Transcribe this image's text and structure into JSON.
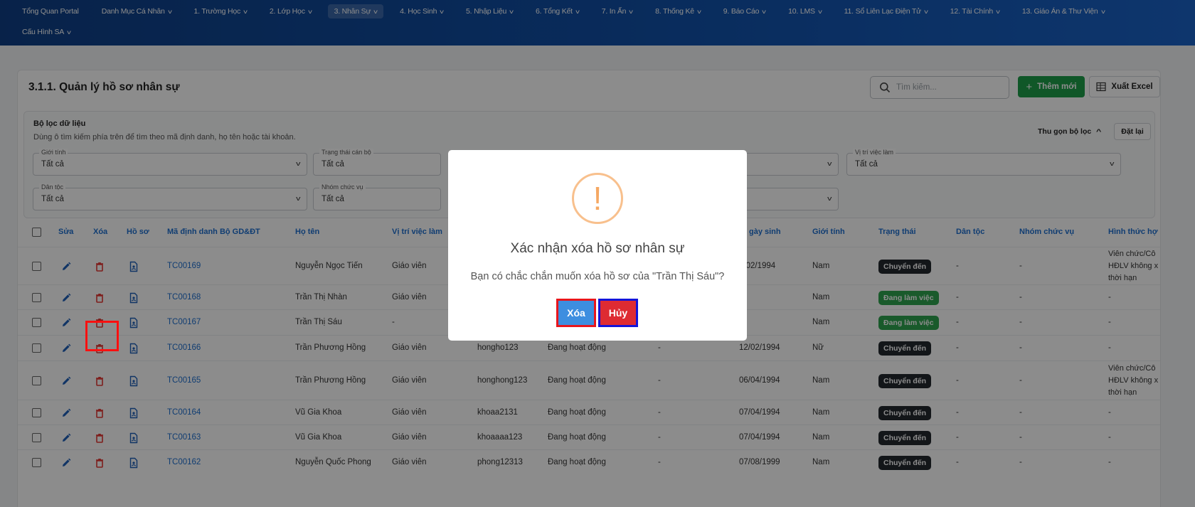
{
  "nav": {
    "row1": [
      {
        "label": "Tổng Quan Portal",
        "chevron": false,
        "active": false
      },
      {
        "label": "Danh Mục Cá Nhân",
        "chevron": true,
        "active": false
      },
      {
        "label": "1. Trường Học",
        "chevron": true,
        "active": false
      },
      {
        "label": "2. Lớp Học",
        "chevron": true,
        "active": false
      },
      {
        "label": "3. Nhân Sự",
        "chevron": true,
        "active": true
      },
      {
        "label": "4. Học Sinh",
        "chevron": true,
        "active": false
      },
      {
        "label": "5. Nhập Liệu",
        "chevron": true,
        "active": false
      },
      {
        "label": "6. Tổng Kết",
        "chevron": true,
        "active": false
      },
      {
        "label": "7. In Ấn",
        "chevron": true,
        "active": false
      },
      {
        "label": "8. Thống Kê",
        "chevron": true,
        "active": false
      },
      {
        "label": "9. Báo Cáo",
        "chevron": true,
        "active": false
      },
      {
        "label": "10. LMS",
        "chevron": true,
        "active": false
      },
      {
        "label": "11. Sổ Liên Lạc Điện Tử",
        "chevron": true,
        "active": false
      },
      {
        "label": "12. Tài Chính",
        "chevron": true,
        "active": false
      },
      {
        "label": "13. Giáo Án & Thư Viện",
        "chevron": true,
        "active": false
      }
    ],
    "row2": [
      {
        "label": "Cấu Hình SA",
        "chevron": true,
        "active": false
      }
    ]
  },
  "page": {
    "title": "3.1.1. Quản lý hồ sơ nhân sự",
    "search_placeholder": "Tìm kiếm...",
    "add_label": "Thêm mới",
    "excel_label": "Xuất Excel"
  },
  "filter": {
    "title": "Bộ lọc dữ liệu",
    "description": "Dùng ô tìm kiếm phía trên để tìm theo mã định danh, họ tên hoặc tài khoản.",
    "collapse_label": "Thu gọn bộ lọc",
    "reset_label": "Đặt lại",
    "fields": [
      {
        "label": "Giới tính",
        "value": "Tất cả"
      },
      {
        "label": "Trạng thái cán bộ",
        "value": "Tất cả"
      },
      {
        "label": "",
        "value": ""
      },
      {
        "label": "Vị trí việc làm",
        "value": "Tất cả"
      },
      {
        "label": "Dân tộc",
        "value": "Tất cả"
      },
      {
        "label": "Nhóm chức vụ",
        "value": "Tất cả"
      },
      {
        "label": "",
        "value": ""
      }
    ]
  },
  "table": {
    "headers": [
      "Sửa",
      "Xóa",
      "Hồ sơ",
      "Mã định danh Bộ GD&ĐT",
      "Họ tên",
      "Vị trí việc làm",
      "gày sinh",
      "Giới tính",
      "Trạng thái",
      "Dân tộc",
      "Nhóm chức vụ",
      "Hình thức hợ"
    ],
    "rows": [
      {
        "code": "TC00169",
        "name": "Nguyễn Ngọc Tiến",
        "position": "Giáo viên",
        "account": "",
        "status_text": "",
        "col8": "",
        "dob": "2/02/1994",
        "gender": "Nam",
        "state": "Chuyển đến",
        "state_color": "dark",
        "ethnic": "-",
        "group": "-",
        "form": "Viên chức/Cô HĐLV không x thời hạn"
      },
      {
        "code": "TC00168",
        "name": "Trần Thị Nhàn",
        "position": "Giáo viên",
        "account": "",
        "status_text": "",
        "col8": "",
        "dob": "",
        "gender": "Nam",
        "state": "Đang làm việc",
        "state_color": "green",
        "ethnic": "-",
        "group": "-",
        "form": "-"
      },
      {
        "code": "TC00167",
        "name": "Trần Thị Sáu",
        "position": "-",
        "account": "",
        "status_text": "",
        "col8": "",
        "dob": "",
        "gender": "Nam",
        "state": "Đang làm việc",
        "state_color": "green",
        "ethnic": "-",
        "group": "-",
        "form": "-"
      },
      {
        "code": "TC00166",
        "name": "Trần Phương Hồng",
        "position": "Giáo viên",
        "account": "hongho123",
        "status_text": "Đang hoạt động",
        "col8": "-",
        "dob": "12/02/1994",
        "gender": "Nữ",
        "state": "Chuyển đến",
        "state_color": "dark",
        "ethnic": "-",
        "group": "-",
        "form": "-"
      },
      {
        "code": "TC00165",
        "name": "Trần Phương Hồng",
        "position": "Giáo viên",
        "account": "honghong123",
        "status_text": "Đang hoạt động",
        "col8": "-",
        "dob": "06/04/1994",
        "gender": "Nam",
        "state": "Chuyển đến",
        "state_color": "dark",
        "ethnic": "-",
        "group": "-",
        "form": "Viên chức/Cô HĐLV không x thời hạn"
      },
      {
        "code": "TC00164",
        "name": "Vũ Gia Khoa",
        "position": "Giáo viên",
        "account": "khoaa2131",
        "status_text": "Đang hoạt động",
        "col8": "-",
        "dob": "07/04/1994",
        "gender": "Nam",
        "state": "Chuyển đến",
        "state_color": "dark",
        "ethnic": "-",
        "group": "-",
        "form": "-"
      },
      {
        "code": "TC00163",
        "name": "Vũ Gia Khoa",
        "position": "Giáo viên",
        "account": "khoaaaa123",
        "status_text": "Đang hoạt động",
        "col8": "-",
        "dob": "07/04/1994",
        "gender": "Nam",
        "state": "Chuyển đến",
        "state_color": "dark",
        "ethnic": "-",
        "group": "-",
        "form": "-"
      },
      {
        "code": "TC00162",
        "name": "Nguyễn Quốc Phong",
        "position": "Giáo viên",
        "account": "phong12313",
        "status_text": "Đang hoạt động",
        "col8": "-",
        "dob": "07/08/1999",
        "gender": "Nam",
        "state": "Chuyển đến",
        "state_color": "dark",
        "ethnic": "-",
        "group": "-",
        "form": "-"
      }
    ]
  },
  "modal": {
    "icon": "!",
    "title": "Xác nhận xóa hồ sơ nhân sự",
    "message": "Bạn có chắc chắn muốn xóa hồ sơ của \"Trần Thị Sáu\"?",
    "confirm_label": "Xóa",
    "cancel_label": "Hủy"
  },
  "colors": {
    "nav_bg": "#1150a8",
    "link_blue": "#1e6fd0",
    "add_green": "#1e9e4a",
    "delete_red": "#e53935",
    "badge_dark": "#24292f",
    "badge_green": "#2ea44f",
    "warning_orange": "#f5a863"
  }
}
